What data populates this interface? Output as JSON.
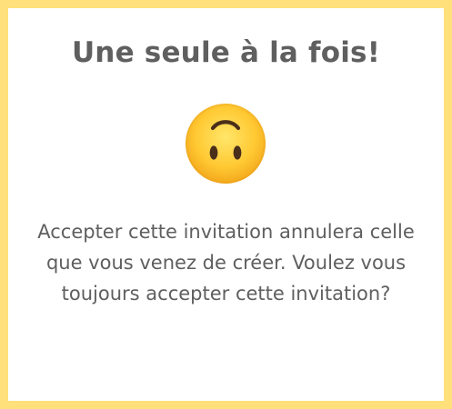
{
  "dialog": {
    "title": "Une seule à la fois!",
    "emoji_icon": "upside-down-face-emoji-icon",
    "message_lines": [
      "Accepter cette invitation annulera celle",
      "que vous venez de créer. Voulez vous",
      "toujours accepter cette invitation?"
    ]
  },
  "colors": {
    "border": "#ffe07a",
    "text": "#5f5f5f",
    "background": "#ffffff"
  }
}
